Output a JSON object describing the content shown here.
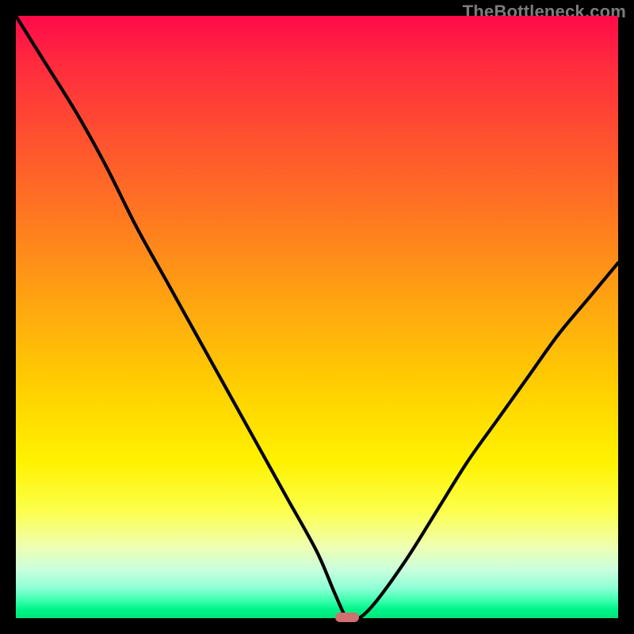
{
  "attribution": "TheBottleneck.com",
  "colors": {
    "page_bg": "#000000",
    "curve_stroke": "#000000",
    "marker_fill": "#d07070",
    "gradient_top": "#ff0a4a",
    "gradient_bottom": "#00e57a"
  },
  "chart_data": {
    "type": "line",
    "title": "",
    "xlabel": "",
    "ylabel": "",
    "xlim": [
      0,
      100
    ],
    "ylim": [
      0,
      100
    ],
    "grid": false,
    "legend": false,
    "x": [
      0,
      5,
      10,
      15,
      20,
      25,
      30,
      35,
      40,
      45,
      50,
      53,
      55,
      57,
      60,
      65,
      70,
      75,
      80,
      85,
      90,
      95,
      100
    ],
    "values": [
      100,
      92,
      84,
      75,
      65,
      56,
      47,
      38,
      29,
      20,
      11,
      4,
      0,
      0,
      3,
      10,
      18,
      26,
      33,
      40,
      47,
      53,
      59
    ],
    "marker": {
      "x_range": [
        53,
        57
      ],
      "y": 0
    },
    "note": "Axes carry no tick labels in the image; values are estimated from curve geometry on a 0–100 normalized scale."
  }
}
